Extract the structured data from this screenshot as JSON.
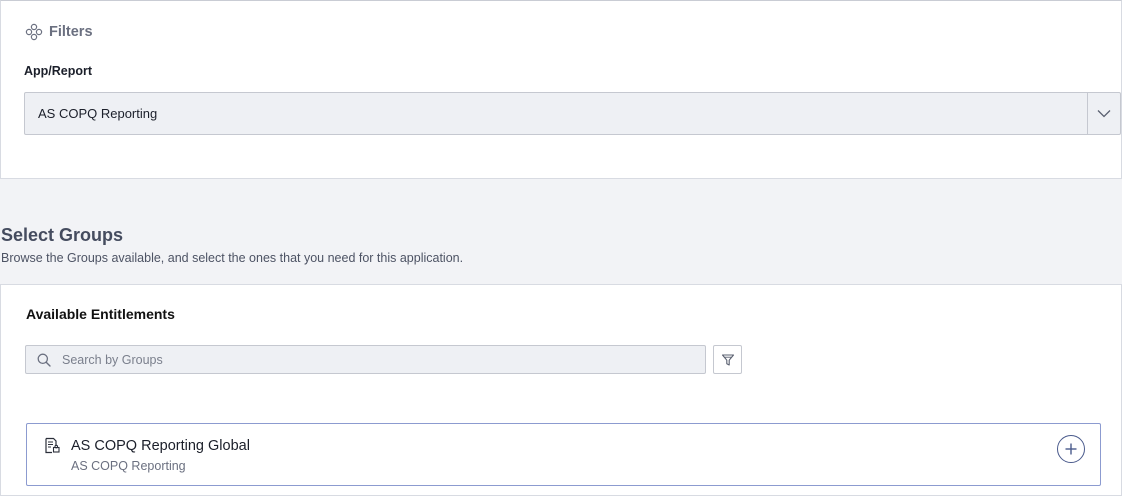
{
  "filters": {
    "title": "Filters",
    "icon": "filters-icon",
    "app_label": "App/Report",
    "app_select": {
      "selected": "AS COPQ Reporting",
      "toggle_icon": "chevron-down-icon"
    }
  },
  "groups": {
    "title": "Select Groups",
    "subtitle": "Browse the Groups available, and select the ones that you need for this application."
  },
  "entitlements": {
    "title": "Available Entitlements",
    "search": {
      "placeholder": "Search by Groups",
      "value": "",
      "icon": "search-icon"
    },
    "filter_icon": "funnel-icon",
    "items": [
      {
        "title": "AS COPQ Reporting Global",
        "subtitle": "AS COPQ Reporting",
        "icon": "report-document-icon",
        "action_icon": "add-circle-icon"
      }
    ]
  },
  "colors": {
    "page_background": "#f2f3f6",
    "panel_background": "#ffffff",
    "input_background": "#eef0f4",
    "card_border": "#8c9bd0",
    "accent": "#4a5a8c"
  }
}
